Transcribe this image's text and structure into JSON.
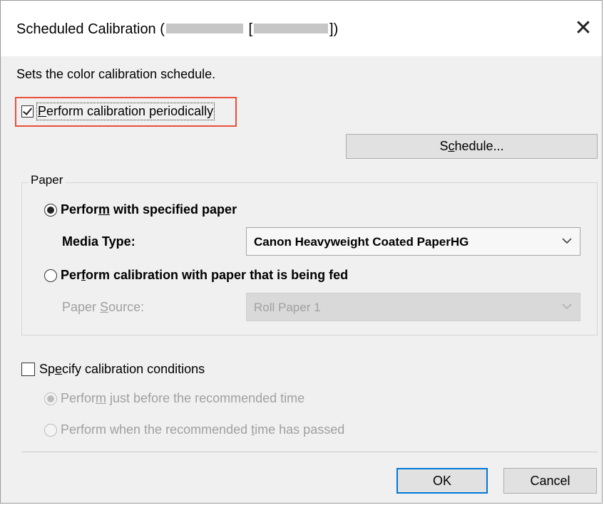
{
  "dialog": {
    "title": "Scheduled Calibration (",
    "title_mid": "[",
    "title_end": "])",
    "close_symbol": "✕",
    "description": "Sets the color calibration schedule."
  },
  "periodic": {
    "checked": true,
    "label_pre": "",
    "label_accel": "P",
    "label_post": "erform calibration periodically"
  },
  "schedule_button": {
    "label_pre": "S",
    "label_accel": "c",
    "label_post": "hedule..."
  },
  "paper_group": {
    "title": "Paper",
    "option_specified": {
      "selected": true,
      "label_pre": "Perfor",
      "label_accel": "m",
      "label_post": " with specified paper"
    },
    "media_type": {
      "label": "Media Type:",
      "value": "Canon Heavyweight Coated PaperHG"
    },
    "option_fed": {
      "selected": false,
      "label_pre": "Per",
      "label_accel": "f",
      "label_post": "orm calibration with paper that is being fed"
    },
    "paper_source": {
      "label_pre": "Paper ",
      "label_accel": "S",
      "label_post": "ource:",
      "value": "Roll Paper 1"
    }
  },
  "conditions": {
    "checked": false,
    "label_pre": "Sp",
    "label_accel": "e",
    "label_post": "cify calibration conditions",
    "option_before": {
      "selected": true,
      "label_pre": "Perfor",
      "label_accel": "m",
      "label_post": " just before the recommended time"
    },
    "option_after": {
      "selected": false,
      "label_pre": "Perform when the recommended ",
      "label_accel": "t",
      "label_post": "ime has passed"
    }
  },
  "footer": {
    "ok_label": "OK",
    "cancel_label": "Cancel"
  },
  "colors": {
    "highlight_border": "#e8503a",
    "ok_border": "#0078d7",
    "dialog_bg": "#f0f0f0"
  }
}
